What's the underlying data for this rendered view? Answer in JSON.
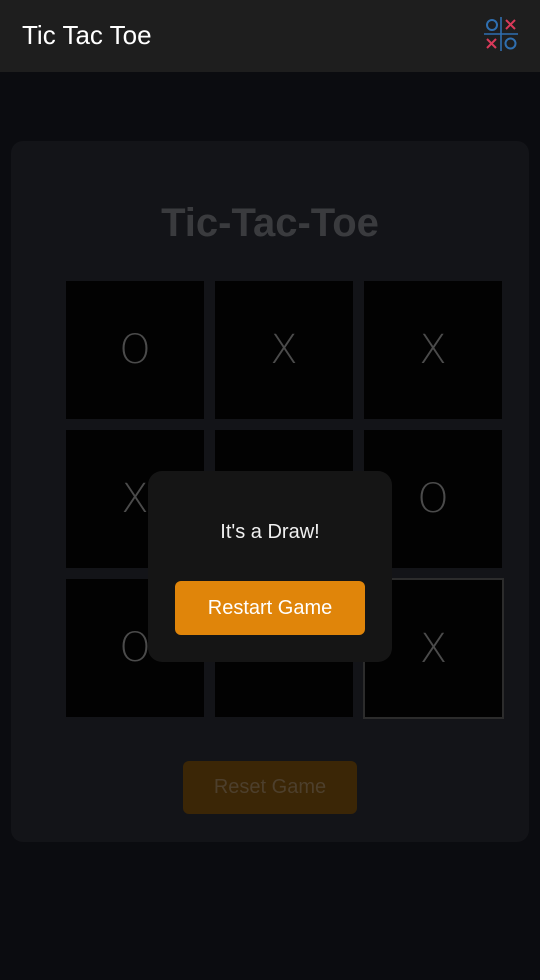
{
  "appbar": {
    "title": "Tic Tac Toe",
    "logo_icon": "tic-tac-toe-logo-icon"
  },
  "game": {
    "title": "Tic-Tac-Toe",
    "board": [
      "O",
      "X",
      "X",
      "X",
      "",
      "O",
      "O",
      "",
      "X"
    ],
    "reset_label": "Reset Game"
  },
  "dialog": {
    "message": "It's a Draw!",
    "restart_label": "Restart Game"
  },
  "colors": {
    "accent": "#e0850a",
    "background": "#0b0c10",
    "appbar": "#1e1e1e",
    "logo_blue": "#2f6fb0",
    "logo_red": "#d93a5a"
  }
}
